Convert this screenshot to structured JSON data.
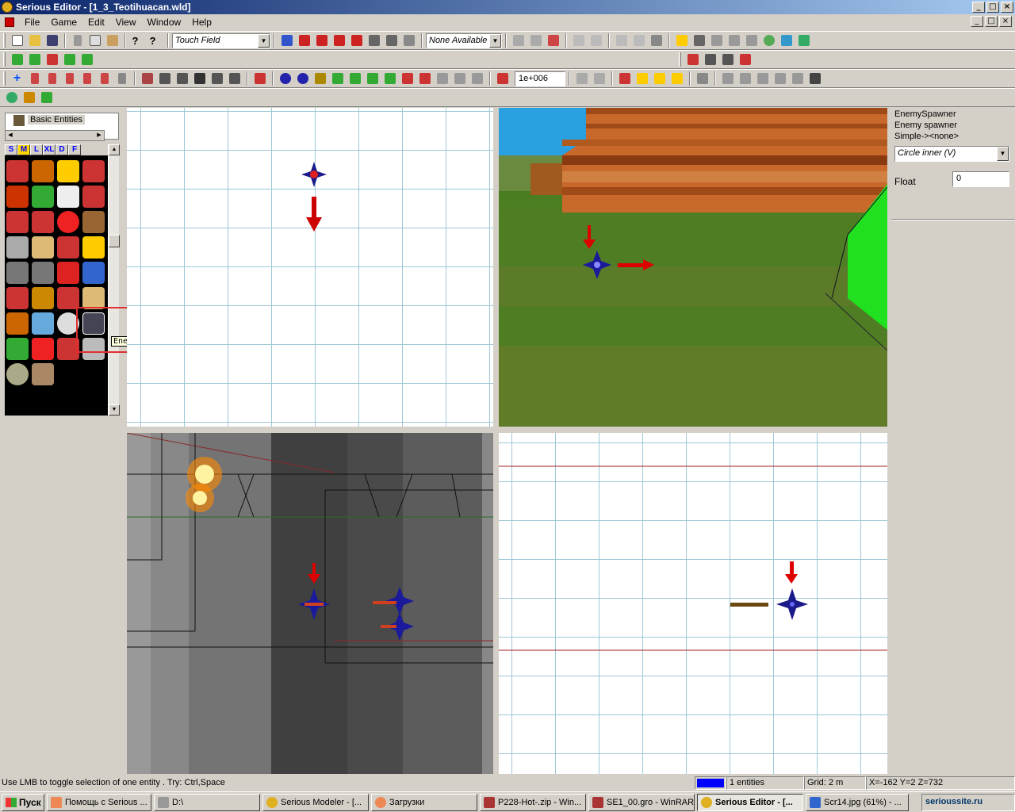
{
  "window": {
    "title": "Serious Editor - [1_3_Teotihuacan.wld]"
  },
  "menu": [
    "File",
    "Game",
    "Edit",
    "View",
    "Window",
    "Help"
  ],
  "toolbar": {
    "entity_combo": "Touch Field",
    "mode_combo": "None Available",
    "value_field": "1e+006"
  },
  "browser": {
    "tree_item": "Basic Entities",
    "tabs": [
      "S",
      "M",
      "L",
      "XL",
      "D",
      "F"
    ],
    "tooltip": "EnemySpawner"
  },
  "properties": {
    "class_name": "EnemySpawner",
    "description": "Enemy spawner",
    "property": "Simple->",
    "property_value": "<none>",
    "dropdown_value": "Circle inner (V)",
    "float_label": "Float",
    "float_value": "0"
  },
  "status": {
    "message": "Use LMB to toggle selection of one entity . Try: Ctrl,Space",
    "entities": "1 entities",
    "grid": "Grid: 2 m",
    "coords": "X=-162 Y=2 Z=732",
    "accent_color": "#0000ff"
  },
  "taskbar": {
    "start": "Пуск",
    "tasks": [
      "Помощь с Serious ...",
      "D:\\",
      "Serious Modeler - [...",
      "Загрузки",
      "P228-Hot-.zip - Win...",
      "SE1_00.gro - WinRAR",
      "Serious Editor - [...",
      "Scr14.jpg (61%) - ..."
    ],
    "tray_text": "serioussite.ru"
  }
}
